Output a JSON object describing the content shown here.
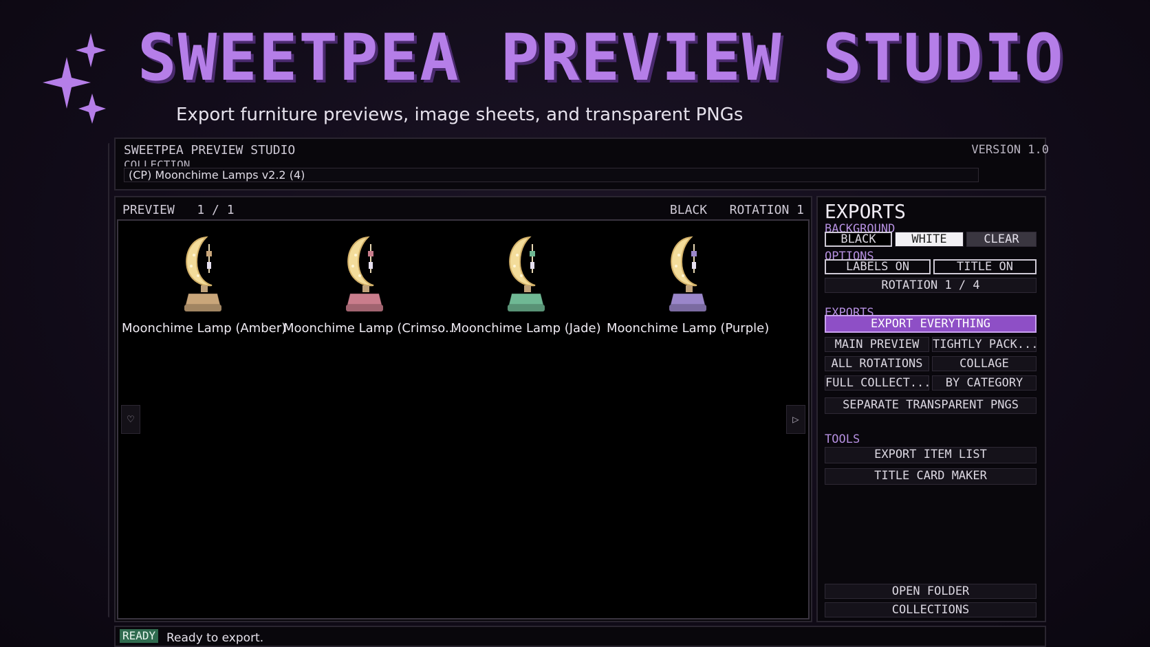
{
  "banner": {
    "title": "SWEETPEA PREVIEW STUDIO",
    "subtitle": "Export furniture previews, image sheets, and transparent PNGs"
  },
  "header": {
    "app_name": "SWEETPEA PREVIEW STUDIO",
    "version": "VERSION 1.0",
    "collection_label": "COLLECTION",
    "collection_value": "(CP) Moonchime Lamps v2.2 (4)"
  },
  "preview": {
    "label": "PREVIEW   1 / 1",
    "background_indicator": "BLACK",
    "rotation_indicator": "ROTATION 1",
    "items": [
      {
        "label": "Moonchime Lamp (Amber)",
        "base_color": "#c9a67a"
      },
      {
        "label": "Moonchime Lamp (Crimso...",
        "base_color": "#c97d8c"
      },
      {
        "label": "Moonchime Lamp (Jade)",
        "base_color": "#6fb894"
      },
      {
        "label": "Moonchime Lamp (Purple)",
        "base_color": "#9a86c9"
      }
    ],
    "prev_icon": "♡",
    "next_icon": "▷"
  },
  "exports": {
    "title": "EXPORTS",
    "background_label": "BACKGROUND",
    "bg_black": "BLACK",
    "bg_white": "WHITE",
    "bg_clear": "CLEAR",
    "options_label": "OPTIONS",
    "labels_toggle": "LABELS  ON",
    "title_toggle": "TITLE  ON",
    "rotation": "ROTATION  1 / 4",
    "exports_label": "EXPORTS",
    "export_everything": "EXPORT EVERYTHING",
    "main_preview": "MAIN PREVIEW",
    "tightly_packed": "TIGHTLY PACK...",
    "all_rotations": "ALL ROTATIONS",
    "collage": "COLLAGE",
    "full_collection": "FULL COLLECT...",
    "by_category": "BY CATEGORY",
    "separate_pngs": "SEPARATE TRANSPARENT PNGS",
    "tools_label": "TOOLS",
    "export_item_list": "EXPORT ITEM LIST",
    "title_card_maker": "TITLE CARD MAKER",
    "open_folder": "OPEN FOLDER",
    "collections": "COLLECTIONS"
  },
  "status": {
    "badge": "READY",
    "message": "Ready to export."
  },
  "colors": {
    "accent": "#b57ee8",
    "primary_button": "#8e4fc6",
    "ready_badge": "#2f6b4f"
  }
}
